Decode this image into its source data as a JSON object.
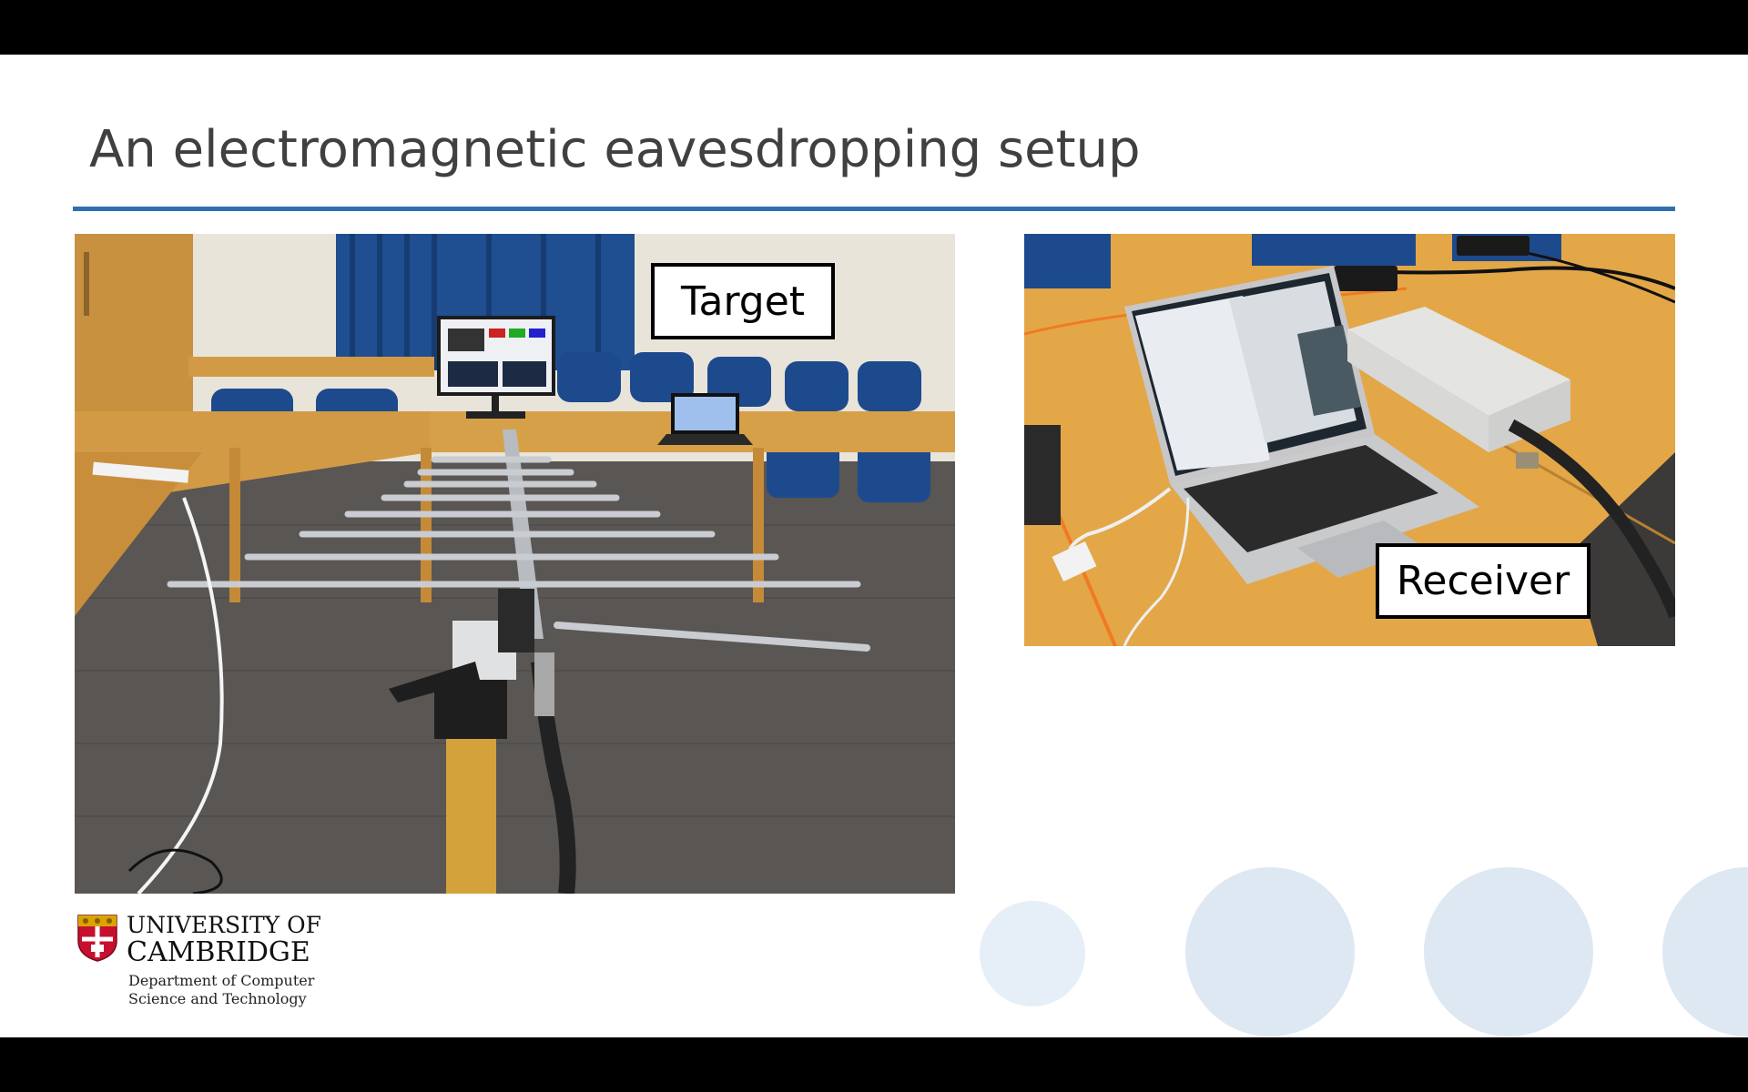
{
  "slide": {
    "title": "An electromagnetic eavesdropping setup"
  },
  "photos": {
    "left_label": "Target",
    "right_label": "Receiver"
  },
  "logo": {
    "line1": "UNIVERSITY OF",
    "line2": "CAMBRIDGE",
    "dept_line1": "Department of Computer",
    "dept_line2": "Science and Technology",
    "crest_icon": "cambridge-crest-icon"
  },
  "colors": {
    "accent_rule": "#2e6fb0",
    "title_text": "#404040",
    "decor_dots": "#dde8f3"
  }
}
